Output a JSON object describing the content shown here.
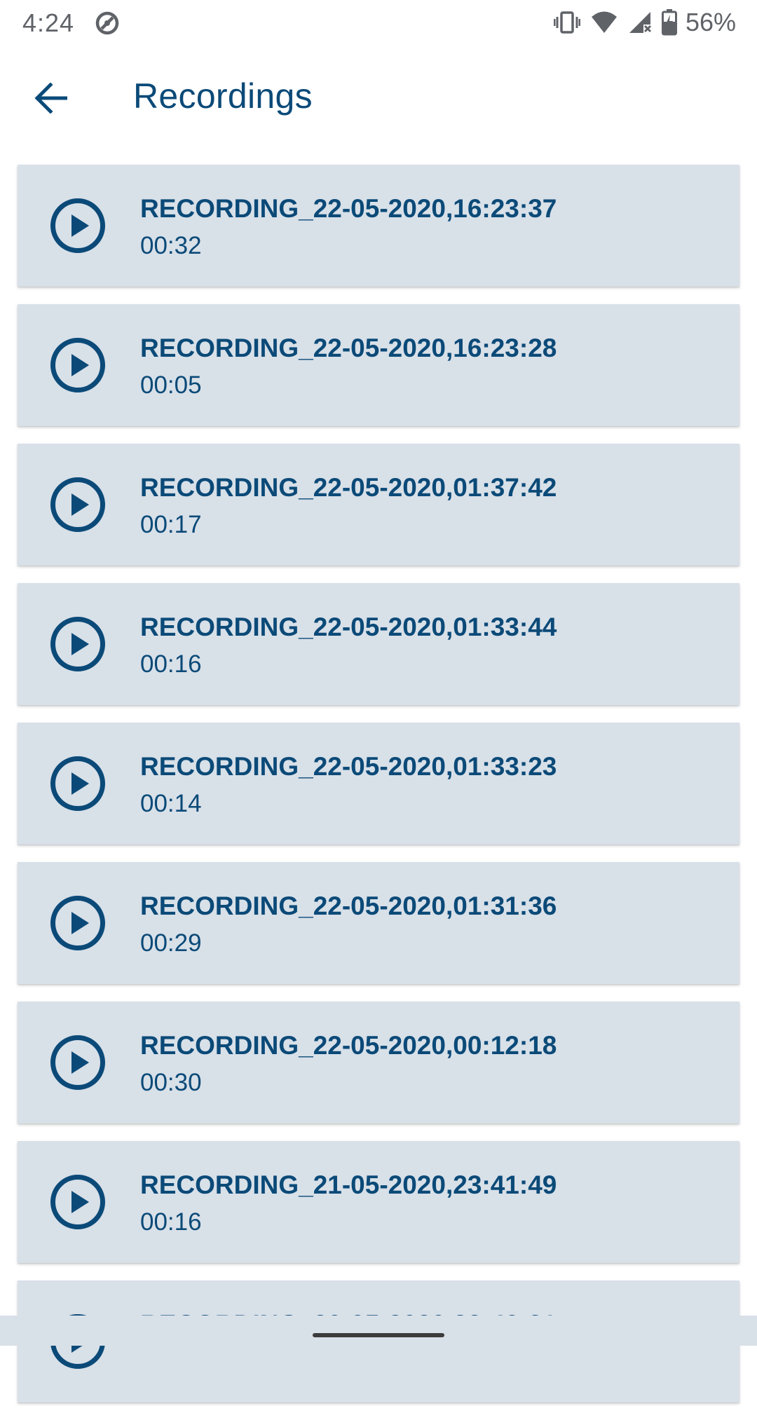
{
  "status_bar": {
    "time": "4:24",
    "battery_percent": "56%",
    "icons": [
      "data-saver-icon",
      "vibrate-icon",
      "wifi-icon",
      "signal-icon",
      "battery-charging-icon"
    ]
  },
  "app_bar": {
    "title": "Recordings",
    "back_icon": "arrow-back-icon"
  },
  "colors": {
    "accent": "#0b4a78",
    "card_background": "#d8e0e8",
    "status_text": "#5f6368"
  },
  "recordings": [
    {
      "name": "RECORDING_22-05-2020,16:23:37",
      "duration": "00:32"
    },
    {
      "name": "RECORDING_22-05-2020,16:23:28",
      "duration": "00:05"
    },
    {
      "name": "RECORDING_22-05-2020,01:37:42",
      "duration": "00:17"
    },
    {
      "name": "RECORDING_22-05-2020,01:33:44",
      "duration": "00:16"
    },
    {
      "name": "RECORDING_22-05-2020,01:33:23",
      "duration": "00:14"
    },
    {
      "name": "RECORDING_22-05-2020,01:31:36",
      "duration": "00:29"
    },
    {
      "name": "RECORDING_22-05-2020,00:12:18",
      "duration": "00:30"
    },
    {
      "name": "RECORDING_21-05-2020,23:41:49",
      "duration": "00:16"
    },
    {
      "name": "RECORDING_20-05-2020,22:40:31",
      "duration": ""
    }
  ]
}
